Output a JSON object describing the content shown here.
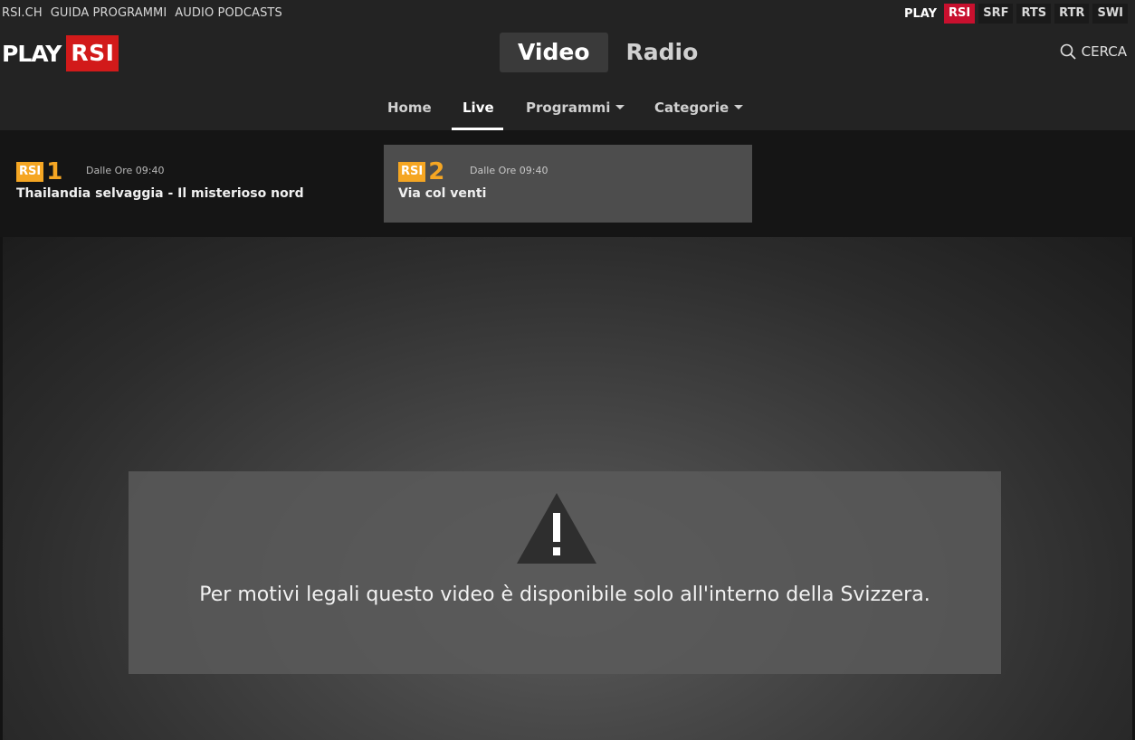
{
  "topbar": {
    "links": [
      "RSI.CH",
      "GUIDA PROGRAMMI",
      "AUDIO PODCASTS"
    ],
    "brand_play": "PLAY",
    "brands": [
      "RSI",
      "SRF",
      "RTS",
      "RTR",
      "SWI"
    ]
  },
  "header": {
    "logo_play": "PLAY",
    "logo_rsi": "RSI",
    "modes": [
      "Video",
      "Radio"
    ],
    "search_label": "CERCA"
  },
  "subnav": {
    "items": [
      "Home",
      "Live",
      "Programmi",
      "Categorie"
    ]
  },
  "channels": [
    {
      "logo_rsi": "RSI",
      "logo_num": "1",
      "time": "Dalle Ore 09:40",
      "title": "Thailandia selvaggia - Il misterioso nord"
    },
    {
      "logo_rsi": "RSI",
      "logo_num": "2",
      "time": "Dalle Ore 09:40",
      "title": "Via col venti"
    }
  ],
  "player": {
    "notice": "Per motivi legali questo video è disponibile solo all'interno della Svizzera."
  },
  "colors": {
    "accent_red": "#d21a1a",
    "channel_orange": "#f5a623"
  }
}
